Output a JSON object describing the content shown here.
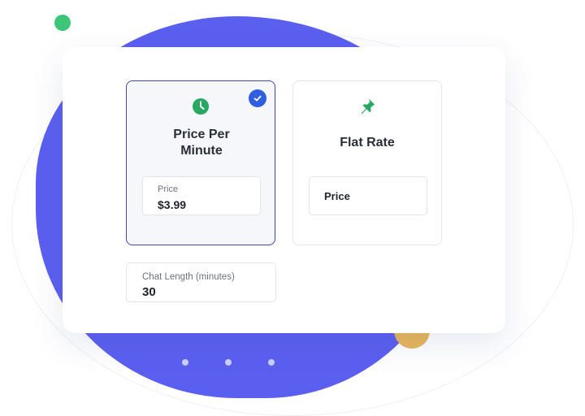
{
  "colors": {
    "accent_blue": "#5b5ff0",
    "check_blue": "#2f5fe0",
    "icon_green": "#28a860",
    "dot_green": "#3dc677",
    "dot_orange": "#e9b65c"
  },
  "pricing_options": [
    {
      "icon": "clock-icon",
      "title": "Price Per Minute",
      "selected": true,
      "price_label": "Price",
      "price_value": "$3.99"
    },
    {
      "icon": "pushpin-icon",
      "title": "Flat Rate",
      "selected": false,
      "price_label": "Price",
      "price_value": ""
    }
  ],
  "chat_length": {
    "label": "Chat Length (minutes)",
    "value": "30"
  },
  "pager": {
    "count": 3
  }
}
